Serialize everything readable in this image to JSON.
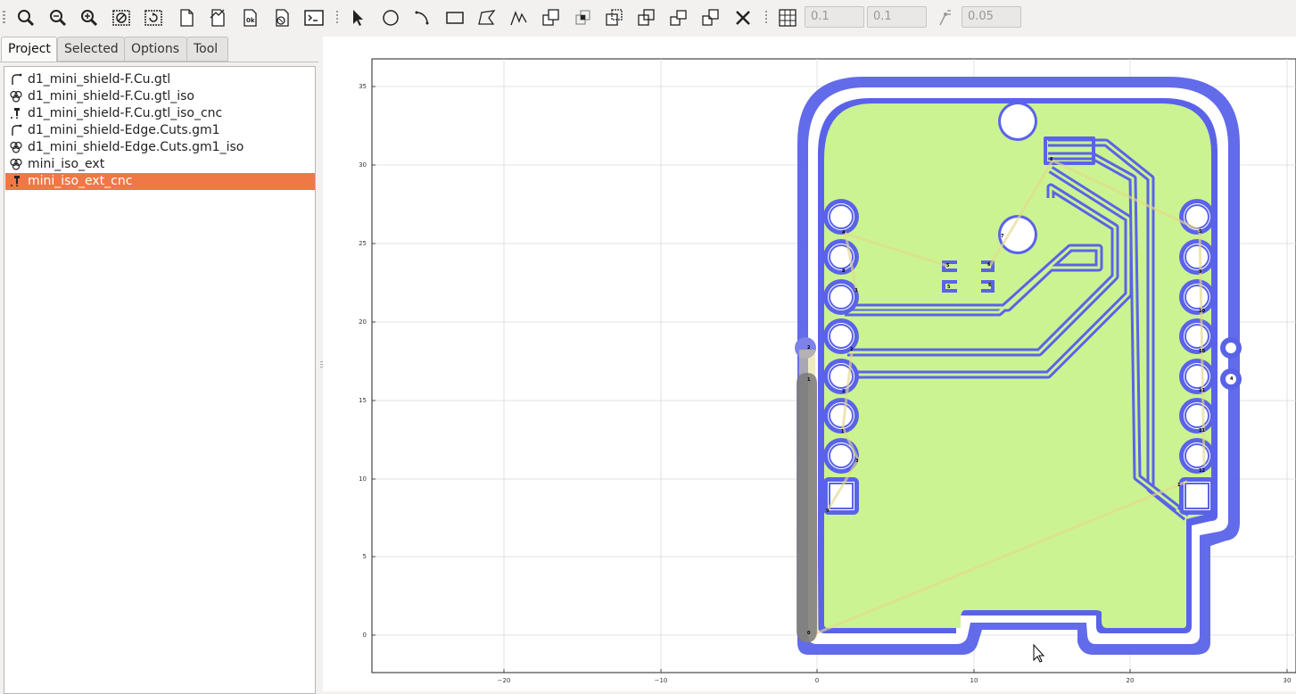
{
  "toolbar": {
    "icons": [
      "zoom-fit-icon",
      "zoom-out-icon",
      "zoom-in-icon",
      "clear-plot-icon",
      "replot-icon",
      "new-geometry-icon",
      "new-path-icon",
      "new-text-icon",
      "new-bitmap-icon",
      "shell-icon",
      "select-icon",
      "circle-icon",
      "arc-icon",
      "rectangle-icon",
      "polygon-icon",
      "path-icon",
      "union-icon",
      "intersection-icon",
      "subtraction-icon",
      "cut-path-icon",
      "copy-icon",
      "move-icon",
      "delete-icon",
      "grid-icon",
      "snap-corner-icon"
    ],
    "grid_x": "0.1",
    "grid_y": "0.1",
    "snap_max": "0.05"
  },
  "tabs": [
    "Project",
    "Selected",
    "Options",
    "Tool"
  ],
  "active_tab": "Project",
  "project": {
    "items": [
      {
        "label": "d1_mini_shield-F.Cu.gtl",
        "icon": "gerber-icon",
        "selected": false
      },
      {
        "label": "d1_mini_shield-F.Cu.gtl_iso",
        "icon": "geometry-icon",
        "selected": false
      },
      {
        "label": "d1_mini_shield-F.Cu.gtl_iso_cnc",
        "icon": "cnc-job-icon",
        "selected": false
      },
      {
        "label": "d1_mini_shield-Edge.Cuts.gm1",
        "icon": "gerber-icon",
        "selected": false
      },
      {
        "label": "d1_mini_shield-Edge.Cuts.gm1_iso",
        "icon": "geometry-icon",
        "selected": false
      },
      {
        "label": "mini_iso_ext",
        "icon": "geometry-icon",
        "selected": false
      },
      {
        "label": "mini_iso_ext_cnc",
        "icon": "cnc-job-icon",
        "selected": true
      }
    ]
  },
  "plot": {
    "x_ticks": [
      "−20",
      "−10",
      "0",
      "10",
      "20",
      "30"
    ],
    "y_ticks": [
      "35",
      "30",
      "25",
      "20",
      "15",
      "10",
      "5",
      "0"
    ],
    "xlim": [
      -28.5,
      30.3
    ],
    "ylim": [
      -2.4,
      36.8
    ],
    "grid": true,
    "colors": {
      "board": "#ccf391",
      "trace": "#5a63e8",
      "toolpath": "#e4d98c",
      "selection": "#7a7a7a"
    },
    "pad_labels": {
      "left": [
        "4",
        "8",
        "3",
        "2",
        "2",
        "1",
        "3",
        "9"
      ],
      "right": [
        "5",
        "9",
        "10",
        "10",
        "11",
        "11",
        "12"
      ],
      "center": [
        "7",
        "5",
        "6",
        "5",
        "6",
        "8",
        "1"
      ],
      "edge": [
        "2",
        "1",
        "4",
        "0"
      ]
    }
  }
}
